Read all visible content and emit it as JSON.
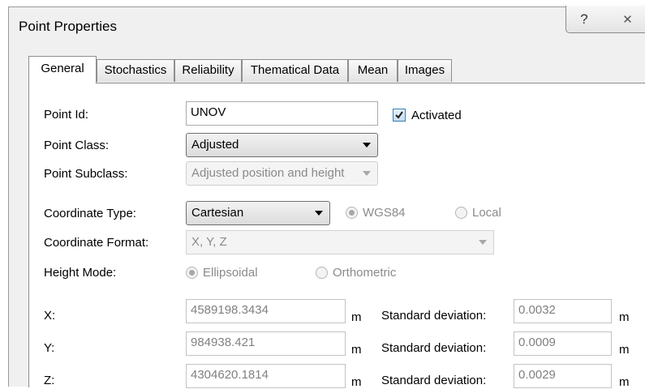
{
  "window": {
    "title": "Point Properties",
    "help_glyph": "?",
    "close_glyph": "✕"
  },
  "tabs": [
    {
      "label": "General",
      "active": true
    },
    {
      "label": "Stochastics",
      "active": false
    },
    {
      "label": "Reliability",
      "active": false
    },
    {
      "label": "Thematical Data",
      "active": false
    },
    {
      "label": "Mean",
      "active": false
    },
    {
      "label": "Images",
      "active": false
    }
  ],
  "general": {
    "point_id": {
      "label": "Point Id:",
      "value": "UNOV"
    },
    "activated": {
      "label": "Activated",
      "checked": true
    },
    "point_class": {
      "label": "Point Class:",
      "value": "Adjusted"
    },
    "point_subclass": {
      "label": "Point Subclass:",
      "value": "Adjusted position and height"
    },
    "coordinate_type": {
      "label": "Coordinate Type:",
      "value": "Cartesian",
      "options": {
        "wgs84": "WGS84",
        "local": "Local"
      },
      "selected": "WGS84"
    },
    "coordinate_format": {
      "label": "Coordinate Format:",
      "value": "X, Y, Z"
    },
    "height_mode": {
      "label": "Height Mode:",
      "options": {
        "ellipsoidal": "Ellipsoidal",
        "orthometric": "Orthometric"
      },
      "selected": "Ellipsoidal"
    },
    "coordinates": [
      {
        "label": "X:",
        "value": "4589198.3434",
        "unit": "m",
        "sd_label": "Standard deviation:",
        "sd_value": "0.0032",
        "sd_unit": "m"
      },
      {
        "label": "Y:",
        "value": "984938.421",
        "unit": "m",
        "sd_label": "Standard deviation:",
        "sd_value": "0.0009",
        "sd_unit": "m"
      },
      {
        "label": "Z:",
        "value": "4304620.1814",
        "unit": "m",
        "sd_label": "Standard deviation:",
        "sd_value": "0.0029",
        "sd_unit": "m"
      }
    ]
  }
}
